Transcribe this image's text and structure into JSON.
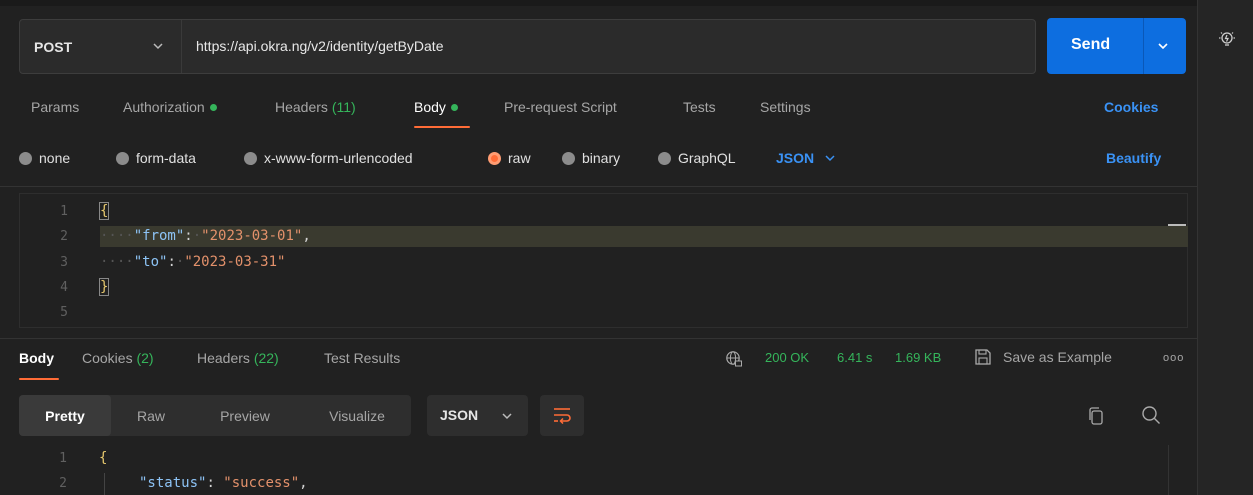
{
  "request": {
    "method": "POST",
    "url": "https://api.okra.ng/v2/identity/getByDate",
    "send_label": "Send"
  },
  "request_tabs": [
    {
      "label": "Params"
    },
    {
      "label": "Authorization"
    },
    {
      "label": "Headers",
      "count": "(11)"
    },
    {
      "label": "Body"
    },
    {
      "label": "Pre-request Script"
    },
    {
      "label": "Tests"
    },
    {
      "label": "Settings"
    }
  ],
  "cookies_link": "Cookies",
  "body_types": {
    "none": "none",
    "form_data": "form-data",
    "urlencoded": "x-www-form-urlencoded",
    "raw": "raw",
    "binary": "binary",
    "graphql": "GraphQL",
    "selected": "raw",
    "language": "JSON"
  },
  "beautify_label": "Beautify",
  "request_body": {
    "line_numbers": [
      "1",
      "2",
      "3",
      "4",
      "5"
    ],
    "open": "{",
    "close": "}",
    "from_key": "\"from\"",
    "from_value": "\"2023-03-01\"",
    "to_key": "\"to\"",
    "to_value": "\"2023-03-31\""
  },
  "response_tabs": [
    {
      "label": "Body"
    },
    {
      "label": "Cookies",
      "count": "(2)"
    },
    {
      "label": "Headers",
      "count": "(22)"
    },
    {
      "label": "Test Results"
    }
  ],
  "response_meta": {
    "status": "200 OK",
    "time": "6.41 s",
    "size": "1.69 KB",
    "save_label": "Save as Example",
    "more": "ooo"
  },
  "view_modes": {
    "pretty": "Pretty",
    "raw": "Raw",
    "preview": "Preview",
    "visualize": "Visualize",
    "selected": "Pretty",
    "language": "JSON"
  },
  "response_body": {
    "line_numbers": [
      "1",
      "2"
    ],
    "open": "{",
    "status_key": "\"status\"",
    "status_value": "\"success\""
  },
  "colors": {
    "accent_orange": "#ff6c37",
    "send_blue": "#0d6ee0",
    "success_green": "#35b55b",
    "link_blue": "#3a92f5"
  },
  "icons": [
    "chevron-down-icon",
    "lightbulb-icon",
    "globe-lock-icon",
    "save-icon",
    "more-icon",
    "wrap-lines-icon",
    "copy-icon",
    "search-icon"
  ]
}
